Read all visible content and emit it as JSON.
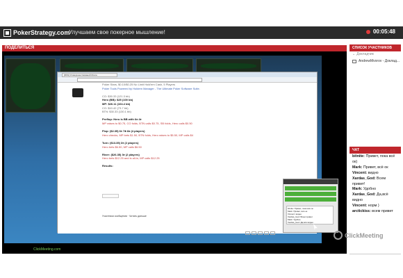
{
  "header": {
    "logo_text": "PokerStrategy.com",
    "session_title": "Улучшаем свое покерное мышление!",
    "timer": "00:05:48"
  },
  "broadcast": {
    "panel_title": "ПОДЕЛИТЬСЯ",
    "footer_text": "ClickMeeting.com",
    "watermark": "ClickMeeting"
  },
  "screen_share": {
    "browser_tab": "[RSS] Усовершенствований Мозга",
    "post": [
      {
        "text": "Poker Stars, $0.10/$0.25 No Limit Hold'em Cash, 5 Players",
        "cls": "grey"
      },
      {
        "text": "Poker Tools Powered by Holdem Manager - The Ultimate Poker Software Suite.",
        "cls": "blue"
      },
      {
        "text": "",
        "cls": "grey"
      },
      {
        "text": "CO: $30.33 (121.3 bb)",
        "cls": "grey"
      },
      {
        "text": "Hero (BB): $25 (100 bb)",
        "cls": "dark bold"
      },
      {
        "text": "MP: $26.11 (104.4 bb)",
        "cls": "dark bold"
      },
      {
        "text": "CO: $10.42 (73.7 bb)",
        "cls": "grey"
      },
      {
        "text": "BTN: $30.33 (130.1 bb)",
        "cls": "grey"
      },
      {
        "text": "",
        "cls": "grey"
      },
      {
        "text": "Preflop: Hero is BB with  6♠ 4♦",
        "cls": "dark bold"
      },
      {
        "text": "MP raises to $0.75, CO folds, BTN calls $0.75, SB folds, Hero calls $0.50",
        "cls": "red"
      },
      {
        "text": "",
        "cls": "grey"
      },
      {
        "text": "Flop: ($2.35)  6♦ 7♣ 8♠  (4 players)",
        "cls": "dark bold"
      },
      {
        "text": "Hero checks, MP bets $1.50, BTN folds, Hero raises to $5.50, MP calls $4",
        "cls": "red"
      },
      {
        "text": "",
        "cls": "grey"
      },
      {
        "text": "Turn: ($13.35)  3♦  (2 players)",
        "cls": "dark bold"
      },
      {
        "text": "Hero bets $6.50, MP calls $6.50",
        "cls": "red"
      },
      {
        "text": "",
        "cls": "grey"
      },
      {
        "text": "River: ($26.35)  3♦  (2 players)",
        "cls": "dark bold"
      },
      {
        "text": "Hero bets $12.25 and is all-in, MP calls $12.25",
        "cls": "red"
      },
      {
        "text": "",
        "cls": "grey"
      },
      {
        "text": "Results:",
        "cls": "dark bold"
      }
    ],
    "reply_button": "Ответить",
    "foot_links": "Участники сообщения · Читать дальше",
    "clickmeeting_panel": {
      "title": "ClickMeeting",
      "rows": [
        "Share desktop",
        "Stop sharing",
        "Chat"
      ],
      "chat_lines": [
        "bitnite: Привет, пока всё ок",
        "Mark: Привет, всё ок",
        "Vincent: видно",
        "Xardas_God: Всем привет",
        "Mark: Удобно",
        "Xardas_God: Да,всё видно"
      ],
      "cursor_label": "AndrewMvorov"
    }
  },
  "participants": {
    "panel_title": "СПИСОК УЧАСТНИКОВ",
    "group_label": "Докладчик",
    "items": [
      "AndrewMvorov - Доклад..."
    ]
  },
  "chat": {
    "panel_title": "ЧАТ",
    "messages": [
      {
        "who": "bitnite:",
        "text": " Привет, пока всё"
      },
      {
        "who": "",
        "text": "ок)"
      },
      {
        "who": "Mark:",
        "text": " Привет, всё ок"
      },
      {
        "who": "Vincent:",
        "text": " видно"
      },
      {
        "who": "Xardas_God:",
        "text": " Всем"
      },
      {
        "who": "",
        "text": "привет!"
      },
      {
        "who": "Mark:",
        "text": " Удобно"
      },
      {
        "who": "Xardas_God:",
        "text": " Да,всё"
      },
      {
        "who": "",
        "text": "видно"
      },
      {
        "who": "Vincent:",
        "text": " норм )"
      },
      {
        "who": "arctickiss:",
        "text": " всем привет"
      }
    ]
  }
}
